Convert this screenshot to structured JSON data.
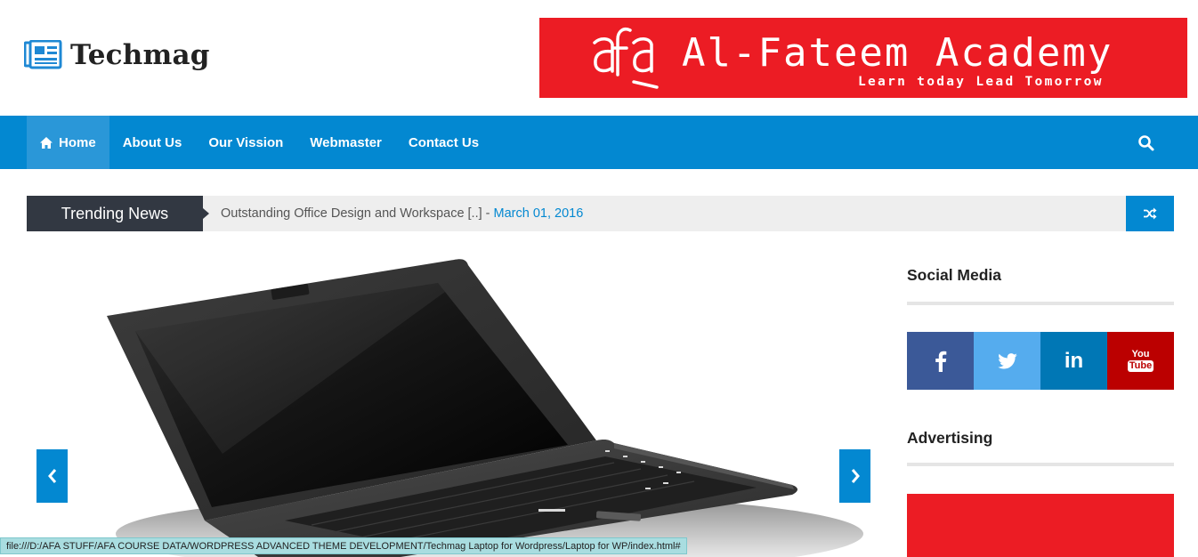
{
  "site": {
    "logo_text": "Techmag",
    "logo_icon": "newspaper-icon"
  },
  "banner": {
    "mark": "afa",
    "title": "Al-Fateem Academy",
    "tagline": "Learn today Lead Tomorrow",
    "color": "#ec1c24"
  },
  "nav": {
    "items": [
      {
        "label": "Home",
        "icon": "home-icon",
        "active": true
      },
      {
        "label": "About Us"
      },
      {
        "label": "Our Vission"
      },
      {
        "label": "Webmaster"
      },
      {
        "label": "Contact Us"
      }
    ],
    "search_icon": "search-icon",
    "color": "#0388d1"
  },
  "trending": {
    "label": "Trending News",
    "headline": "Outstanding Office Design and Workspace [..] -",
    "date": "March 01, 2016",
    "shuffle_icon": "shuffle-icon"
  },
  "slider": {
    "image": "laptop-image",
    "prev_icon": "chevron-left-icon",
    "next_icon": "chevron-right-icon"
  },
  "sidebar": {
    "social_title": "Social Media",
    "social": [
      {
        "name": "facebook",
        "icon": "facebook-icon",
        "color": "#3b5998"
      },
      {
        "name": "twitter",
        "icon": "twitter-icon",
        "color": "#55acee"
      },
      {
        "name": "linkedin",
        "icon": "linkedin-icon",
        "color": "#0077b5",
        "text": "in"
      },
      {
        "name": "youtube",
        "icon": "youtube-icon",
        "color": "#bb0000",
        "text_top": "You",
        "text_bottom": "Tube"
      }
    ],
    "ad_title": "Advertising"
  },
  "status_bar": {
    "url": "file:///D:/AFA STUFF/AFA COURSE DATA/WORDPRESS ADVANCED THEME DEVELOPMENT/Techmag Laptop for Wordpress/Laptop for WP/index.html#"
  }
}
